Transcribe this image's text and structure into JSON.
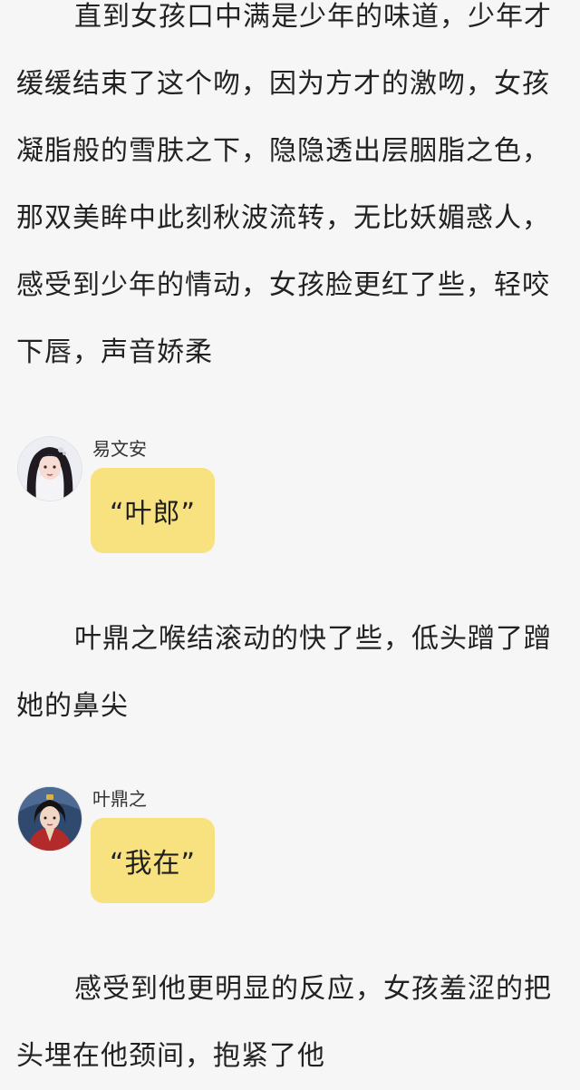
{
  "colors": {
    "page_background": "#f6f6f6",
    "text": "#222222",
    "bubble": "#f8e27f"
  },
  "story": {
    "paragraphs": [
      "直到女孩口中满是少年的味道，少年才缓缓结束了这个吻，因为方才的激吻，女孩凝脂般的雪肤之下，隐隐透出层胭脂之色，那双美眸中此刻秋波流转，无比妖媚惑人，感受到少年的情动，女孩脸更红了些，轻咬下唇，声音娇柔",
      "叶鼎之喉结滚动的快了些，低头蹭了蹭她的鼻尖",
      "感受到他更明显的反应，女孩羞涩的把头埋在他颈间，抱紧了他"
    ],
    "dialogues": [
      {
        "speaker": "易文安",
        "text": "“叶郎”",
        "avatar_icon": "female-character-avatar-icon"
      },
      {
        "speaker": "叶鼎之",
        "text": "“我在”",
        "avatar_icon": "male-character-avatar-icon"
      }
    ]
  }
}
